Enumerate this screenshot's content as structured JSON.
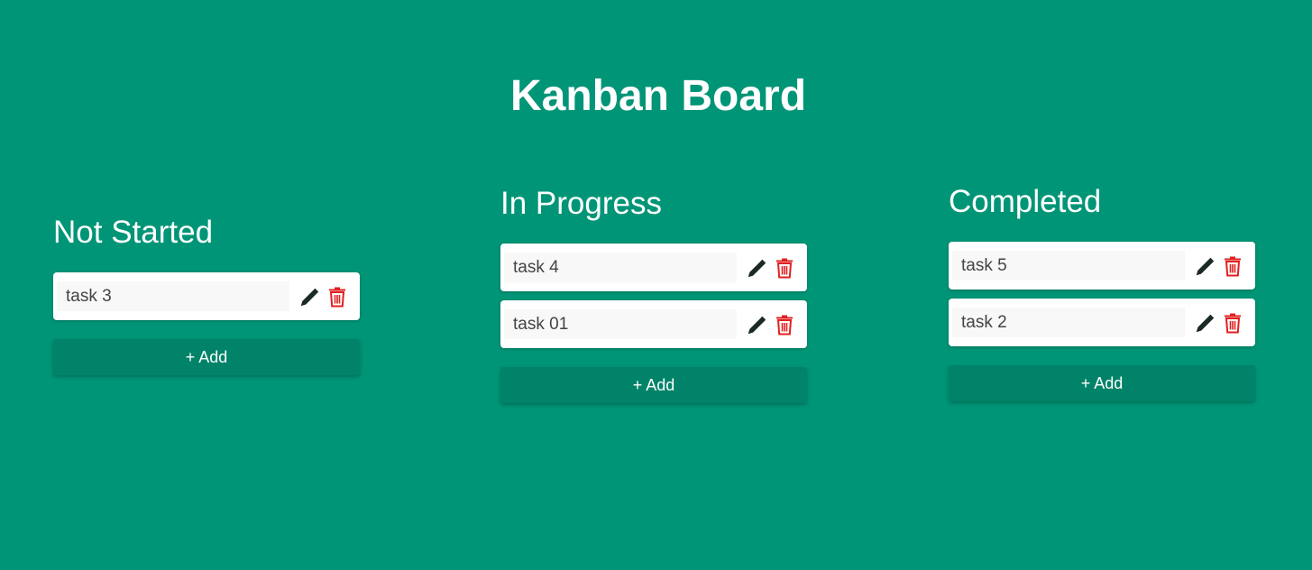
{
  "page": {
    "title": "Kanban Board"
  },
  "colors": {
    "background": "#009577",
    "card": "#ffffff",
    "add_button": "#008368",
    "edit_icon": "#1b2a26",
    "delete_icon": "#e02020"
  },
  "icons": {
    "edit": "pencil-icon",
    "delete": "trash-icon"
  },
  "columns": [
    {
      "title": "Not Started",
      "tasks": [
        "task 3"
      ],
      "add_label": "+ Add"
    },
    {
      "title": "In Progress",
      "tasks": [
        "task 4",
        "task 01"
      ],
      "add_label": "+ Add"
    },
    {
      "title": "Completed",
      "tasks": [
        "task 5",
        "task 2"
      ],
      "add_label": "+ Add"
    }
  ]
}
